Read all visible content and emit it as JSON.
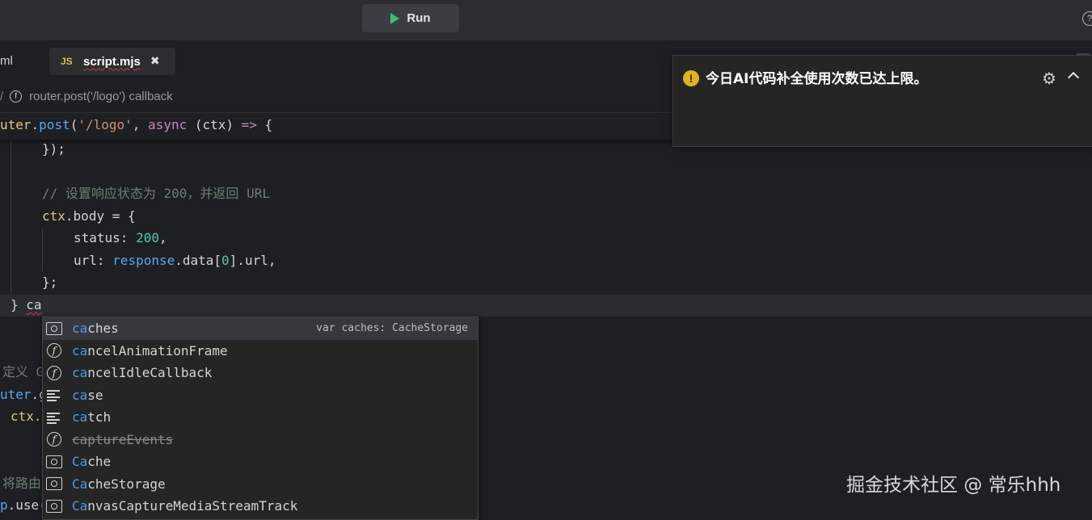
{
  "toolbar": {
    "run_label": "Run",
    "help_glyph": "?"
  },
  "tabs": {
    "left_partial": "ml",
    "active": {
      "badge": "JS",
      "label": "script.mjs",
      "close_glyph": "✖"
    }
  },
  "breadcrumb": {
    "sep": "/",
    "icon_glyph": "f",
    "label": "router.post('/logo') callback"
  },
  "editor": {
    "sticky_line": {
      "obj": "uter",
      "p1": ".",
      "method": "post",
      "p2": "(",
      "str": "'/logo'",
      "p3": ", ",
      "kw": "async",
      "p4": " (ctx) ",
      "arrow": "=>",
      "p5": " {"
    },
    "line_close_obj": "});",
    "comment": "// 设置响应状态为 200，并返回 URL",
    "body_line": {
      "obj": "ctx",
      "p1": ".",
      "prop": "body",
      "p2": " = {"
    },
    "status_line": {
      "key": "status",
      "p1": ": ",
      "num": "200",
      "p2": ","
    },
    "url_line": {
      "key": "url",
      "p1": ": ",
      "obj": "response",
      "p2": ".data[",
      "num": "0",
      "p3": "].url,"
    },
    "close_body": "};",
    "current_line": {
      "brace": "} ",
      "typed": "ca"
    },
    "below": {
      "comment_partial": "定义 G",
      "router_get": {
        "obj": "uter",
        "p": ".g"
      },
      "ctx_partial": "ctx.",
      "comment2_partial": "将路由",
      "use_partial": {
        "obj": "p",
        "p": ".use("
      }
    }
  },
  "suggestions": [
    {
      "match": "ca",
      "rest": "ches",
      "icon": "variable-icon",
      "detail": "var caches: CacheStorage",
      "selected": true,
      "deprecated": false
    },
    {
      "match": "ca",
      "rest": "ncelAnimationFrame",
      "icon": "function-icon",
      "detail": "",
      "selected": false,
      "deprecated": false
    },
    {
      "match": "ca",
      "rest": "ncelIdleCallback",
      "icon": "function-icon",
      "detail": "",
      "selected": false,
      "deprecated": false
    },
    {
      "match": "ca",
      "rest": "se",
      "icon": "keyword-icon",
      "detail": "",
      "selected": false,
      "deprecated": false
    },
    {
      "match": "ca",
      "rest": "tch",
      "icon": "keyword-icon",
      "detail": "",
      "selected": false,
      "deprecated": false
    },
    {
      "match": "ca",
      "rest": "ptureEvents",
      "icon": "function-icon",
      "detail": "",
      "selected": false,
      "deprecated": true
    },
    {
      "match": "Ca",
      "rest": "che",
      "icon": "variable-icon",
      "detail": "",
      "selected": false,
      "deprecated": false
    },
    {
      "match": "Ca",
      "rest": "cheStorage",
      "icon": "variable-icon",
      "detail": "",
      "selected": false,
      "deprecated": false
    },
    {
      "match": "Ca",
      "rest": "nvasCaptureMediaStreamTrack",
      "icon": "variable-icon",
      "detail": "",
      "selected": false,
      "deprecated": false
    }
  ],
  "notification": {
    "icon_glyph": "!",
    "message": "今日AI代码补全使用次数已达上限。",
    "gear_glyph": "⚙"
  },
  "watermark": "掘金技术社区 @ 常乐hhh",
  "colors": {
    "accent_match": "#4f9ae6",
    "warning": "#e3b21b",
    "run_play": "#38c172"
  }
}
